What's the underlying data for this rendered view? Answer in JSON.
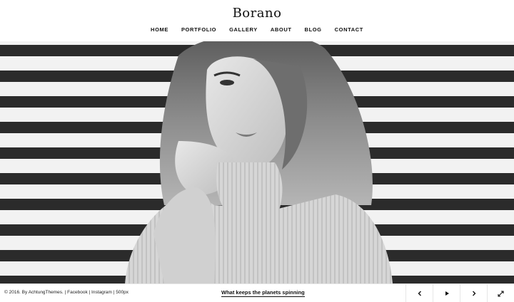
{
  "site": {
    "title": "Borano"
  },
  "nav": [
    {
      "label": "HOME"
    },
    {
      "label": "PORTFOLIO"
    },
    {
      "label": "GALLERY"
    },
    {
      "label": "ABOUT"
    },
    {
      "label": "BLOG"
    },
    {
      "label": "CONTACT"
    }
  ],
  "hero": {
    "image_icon": "portrait-photo"
  },
  "footer": {
    "copyright": "© 2016. By AchtungThemes.",
    "sep1": "|",
    "facebook": "Facebook",
    "sep2": "|",
    "instagram": "Instagram",
    "sep3": "|",
    "px500": "500px",
    "caption": "What keeps the planets spinning"
  },
  "controls": {
    "prev_icon": "chevron-left-icon",
    "play_icon": "play-icon",
    "next_icon": "chevron-right-icon",
    "fullscreen_icon": "fullscreen-icon"
  },
  "colors": {
    "text": "#111111",
    "border": "#e6e6e6",
    "background": "#ffffff"
  }
}
